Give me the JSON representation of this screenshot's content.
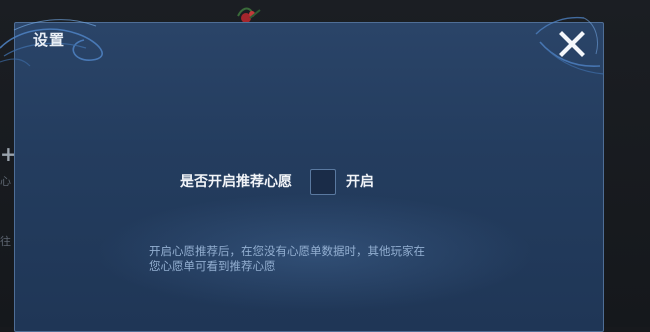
{
  "background": {
    "fragments": [
      "心",
      "往"
    ]
  },
  "dialog": {
    "title": "设置",
    "close_icon": "close-icon",
    "setting": {
      "label": "是否开启推荐心愿",
      "checked": false,
      "state_label": "开启"
    },
    "hint_lines": [
      "开启心愿推荐后，在您没有心愿单数据时，其他玩家在",
      "您心愿单可看到推荐心愿"
    ]
  },
  "colors": {
    "dialog_bg": "#243d5f",
    "dialog_border": "#4f6e96",
    "title_text": "#e9eef5",
    "hint_text": "#93afd1",
    "checkbox_bg": "#1a2c48"
  }
}
